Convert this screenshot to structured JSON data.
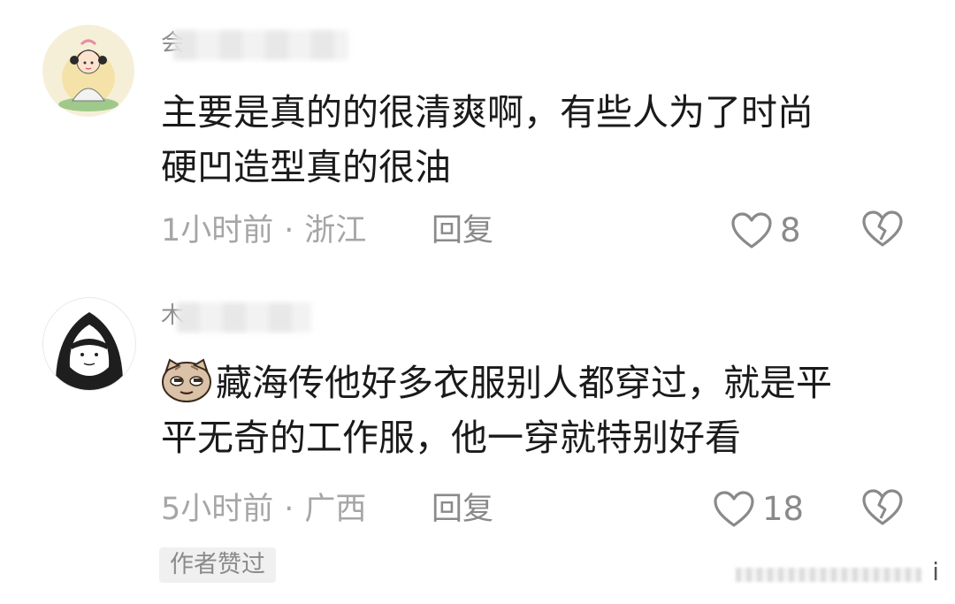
{
  "comments": [
    {
      "username_visible": "会",
      "text_line1": "主要是真的的很清爽啊，有些人为了时尚",
      "text_line2": "硬凹造型真的很油",
      "time": "1小时前",
      "separator": "·",
      "location": "浙江",
      "reply_label": "回复",
      "likes": "8",
      "avatar_icon": "cartoon-girl-avatar"
    },
    {
      "username_visible": "木",
      "text_line1": "藏海传他好多衣服别人都穿过，就是平",
      "text_line2": "平无奇的工作服，他一穿就特别好看",
      "time": "5小时前",
      "separator": "·",
      "location": "广西",
      "reply_label": "回复",
      "likes": "18",
      "avatar_icon": "hooded-figure-avatar",
      "emoji_icon": "smug-cat-emoji",
      "author_badge": "作者赞过"
    }
  ],
  "watermark_text": "i",
  "colors": {
    "text": "#1a1a1a",
    "meta": "#a6a6a6",
    "icon": "#8a8a8a"
  }
}
